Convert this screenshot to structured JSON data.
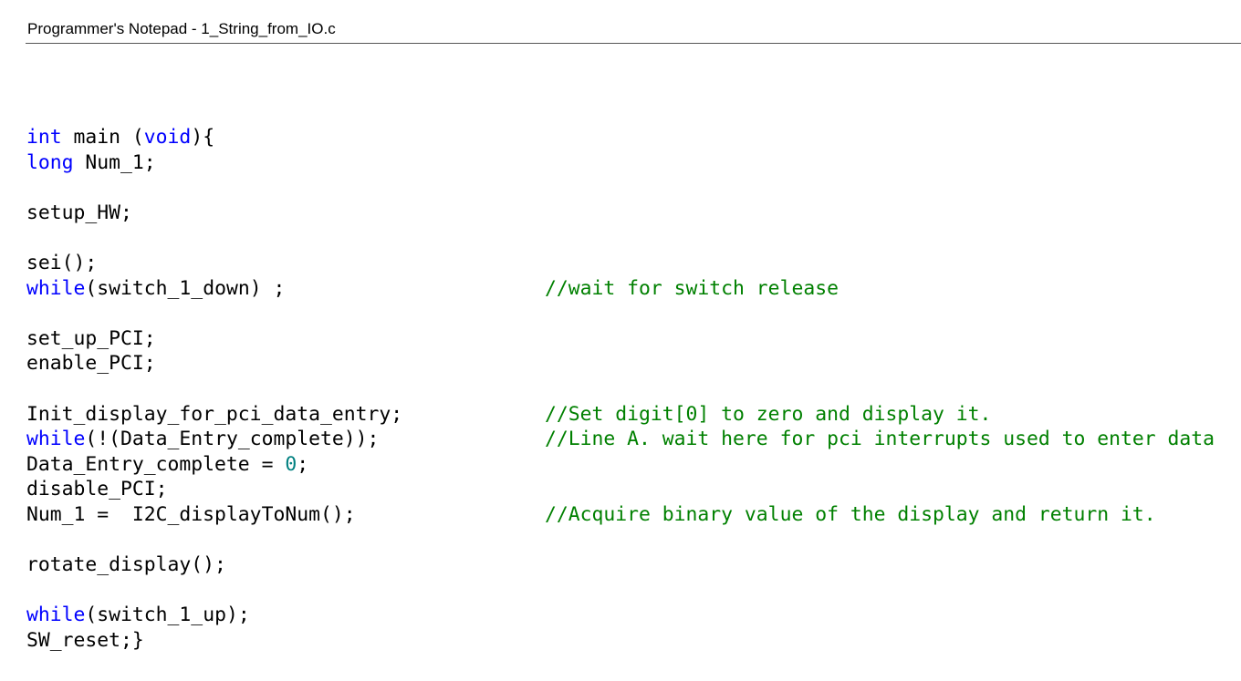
{
  "window": {
    "title": "Programmer's Notepad - 1_String_from_IO.c"
  },
  "editor": {
    "colors": {
      "keyword": "#0000ff",
      "comment": "#008000",
      "number": "#008080",
      "text": "#000000"
    },
    "lines": [
      {
        "kw": "int",
        "rest": " main (",
        "kw2": "void",
        "rest2": "){"
      },
      {
        "kw": "long",
        "rest": " Num_1;"
      },
      {
        "code": ""
      },
      {
        "code": "setup_HW;"
      },
      {
        "code": ""
      },
      {
        "code": "sei();"
      },
      {
        "kw": "while",
        "rest": "(switch_1_down) ;",
        "comment": "//wait for switch release"
      },
      {
        "code": ""
      },
      {
        "code": "set_up_PCI;"
      },
      {
        "code": "enable_PCI;"
      },
      {
        "code": ""
      },
      {
        "code": "Init_display_for_pci_data_entry;",
        "comment": "//Set digit[0] to zero and display it."
      },
      {
        "kw": "while",
        "rest": "(!(Data_Entry_complete));",
        "comment": "//Line A. wait here for pci interrupts used to enter data"
      },
      {
        "code": "Data_Entry_complete = ",
        "num": "0",
        "tail": ";"
      },
      {
        "code": "disable_PCI;"
      },
      {
        "code": "Num_1 =  I2C_displayToNum();",
        "comment": "//Acquire binary value of the display and return it."
      },
      {
        "code": ""
      },
      {
        "code": "rotate_display();"
      },
      {
        "code": ""
      },
      {
        "kw": "while",
        "rest": "(switch_1_up);"
      },
      {
        "code": "SW_reset;}"
      }
    ]
  }
}
